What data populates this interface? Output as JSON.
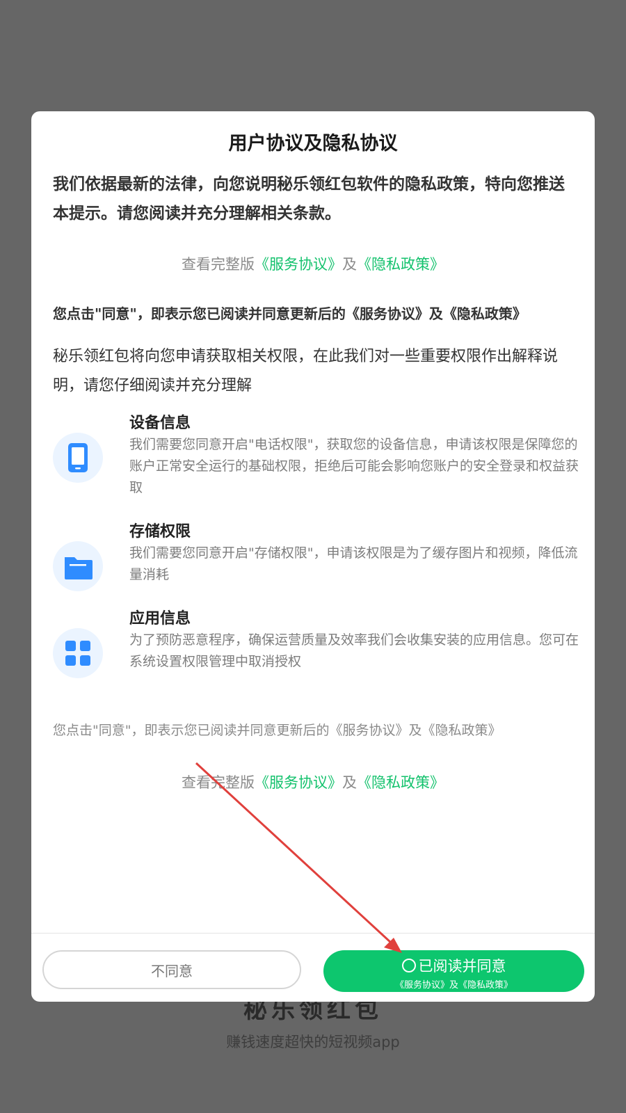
{
  "background": {
    "app_name": "秘乐领红包",
    "tagline": "赚钱速度超快的短视频app"
  },
  "dialog": {
    "title": "用户协议及隐私协议",
    "intro": "我们依据最新的法律，向您说明秘乐领红包软件的隐私政策，特向您推送本提示。请您阅读并充分理解相关条款。",
    "links_prefix": "查看完整版",
    "service_link": "《服务协议》",
    "links_and": "及",
    "privacy_link": "《隐私政策》",
    "bold_notice": "您点击\"同意\"，即表示您已阅读并同意更新后的《服务协议》及《隐私政策》",
    "permission_intro": "秘乐领红包将向您申请获取相关权限，在此我们对一些重要权限作出解释说明，请您仔细阅读并充分理解",
    "permissions": [
      {
        "icon": "phone-icon",
        "title": "设备信息",
        "desc": "我们需要您同意开启\"电话权限\"，获取您的设备信息，申请该权限是保障您的账户正常安全运行的基础权限，拒绝后可能会影响您账户的安全登录和权益获取"
      },
      {
        "icon": "folder-icon",
        "title": "存储权限",
        "desc": "我们需要您同意开启\"存储权限\"，申请该权限是为了缓存图片和视频，降低流量消耗"
      },
      {
        "icon": "apps-grid-icon",
        "title": "应用信息",
        "desc": "为了预防恶意程序，确保运营质量及效率我们会收集安装的应用信息。您可在系统设置权限管理中取消授权"
      }
    ],
    "plain_notice": "您点击\"同意\"，即表示您已阅读并同意更新后的《服务协议》及《隐私政策》",
    "disagree_label": "不同意",
    "agree_label": "已阅读并同意",
    "agree_sub": "《服务协议》及《隐私政策》"
  },
  "colors": {
    "accent_green": "#0dc66e",
    "link_green": "#14c26d",
    "icon_blue": "#2f8cff",
    "annotation_arrow": "#e0403c"
  }
}
